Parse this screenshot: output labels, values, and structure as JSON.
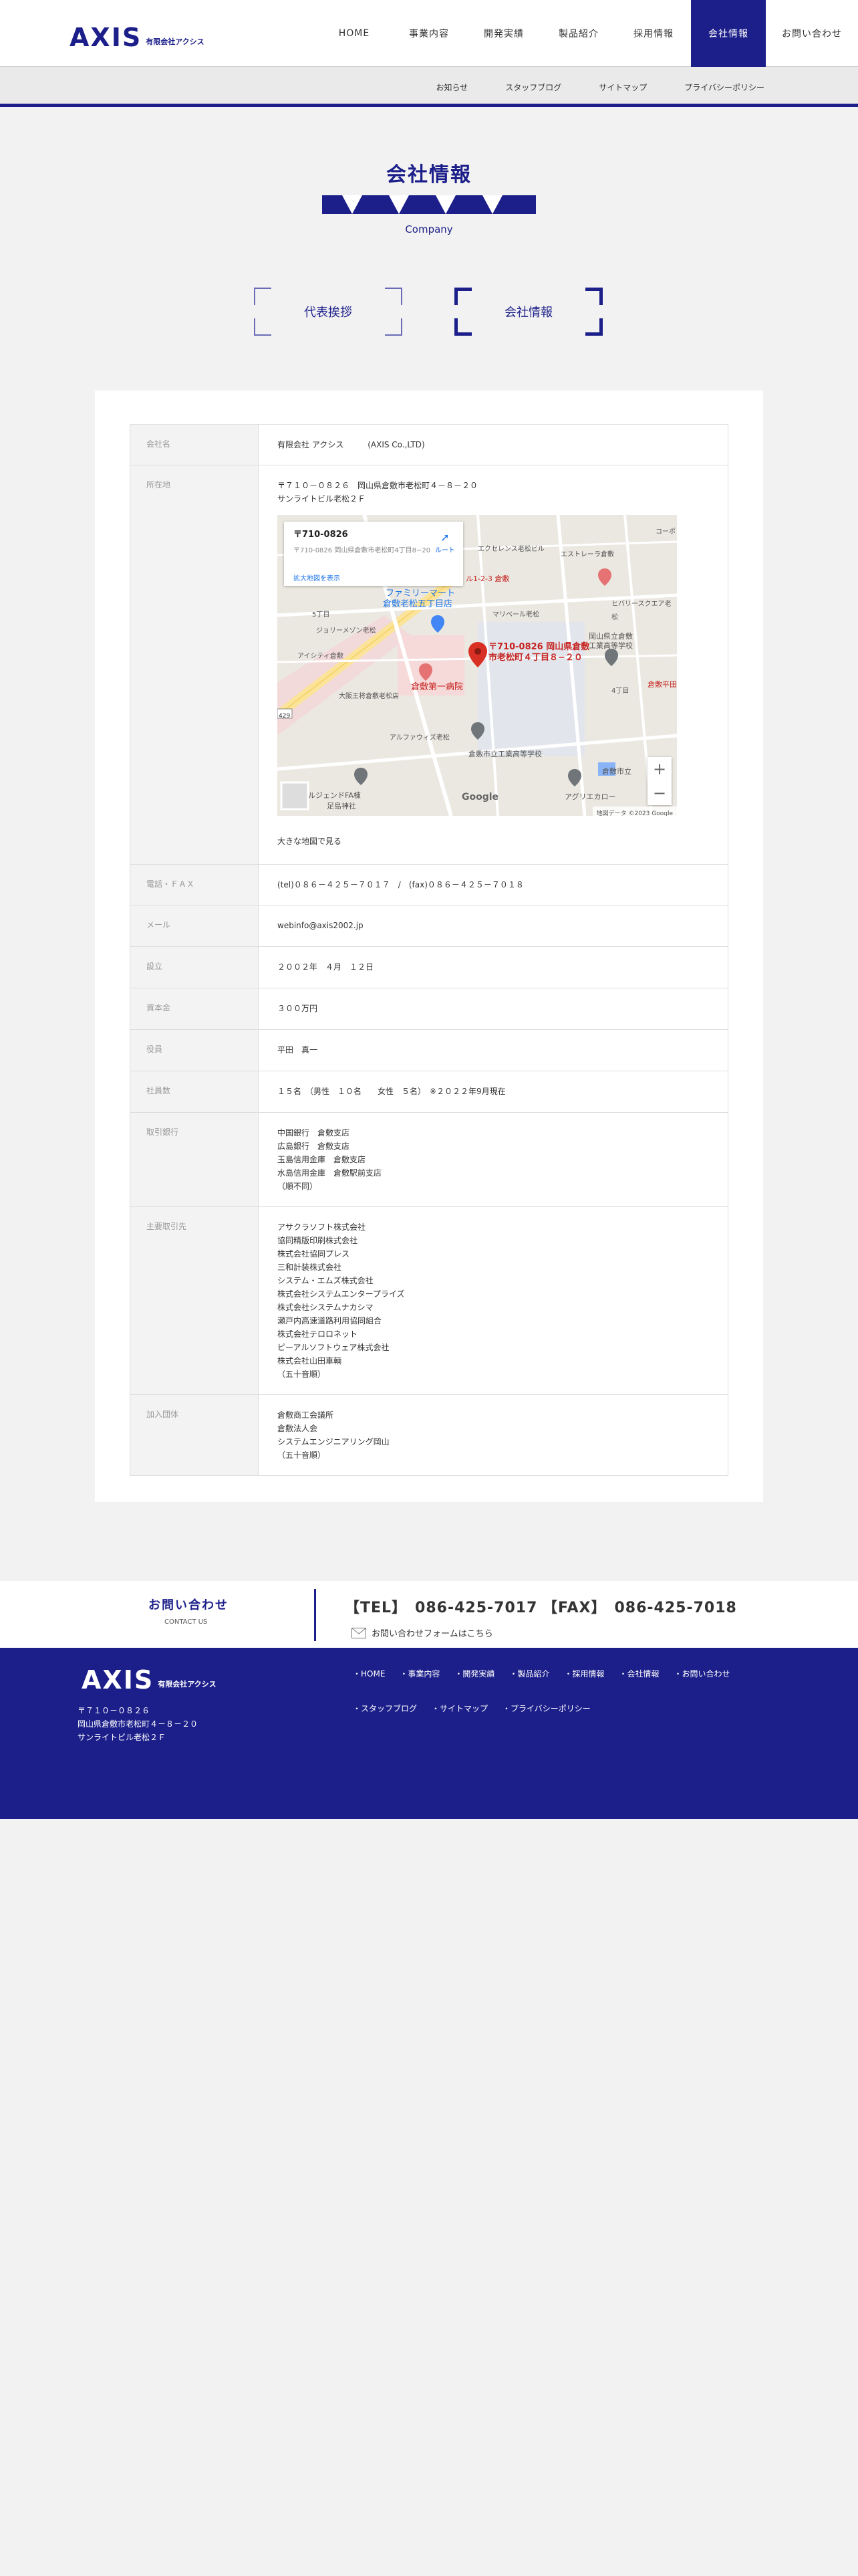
{
  "header": {
    "logo_text": "AXIS",
    "logo_sub": "有限会社アクシス",
    "nav": [
      {
        "label": "HOME"
      },
      {
        "label": "事業内容"
      },
      {
        "label": "開発実績"
      },
      {
        "label": "製品紹介"
      },
      {
        "label": "採用情報"
      },
      {
        "label": "会社情報",
        "active": true
      },
      {
        "label": "お問い合わせ"
      }
    ],
    "subnav": [
      "お知らせ",
      "スタッフブログ",
      "サイトマップ",
      "プライバシーポリシー"
    ]
  },
  "page": {
    "title": "会社情報",
    "title_en": "Company",
    "anchors": [
      "代表挨拶",
      "会社情報"
    ]
  },
  "company": {
    "rows": [
      {
        "label": "会社名",
        "value": "有限会社 アクシス　　　(AXIS Co.,LTD)"
      },
      {
        "label": "所在地"
      },
      {
        "label": "電話・ＦＡＸ",
        "value": "(tel)０８６－４２５－７０１７　/　(fax)０８６－４２５－７０１８"
      },
      {
        "label": "メール",
        "value": "webinfo@axis2002.jp"
      },
      {
        "label": "設立",
        "value": "２００２年　４月　１２日"
      },
      {
        "label": "資本金",
        "value": "３００万円"
      },
      {
        "label": "役員",
        "value": "平田　真一"
      },
      {
        "label": "社員数",
        "value": "１５名　（男性　１０名　　女性　５名）　※２０２２年9月現在"
      },
      {
        "label": "取引銀行",
        "lines": [
          "中国銀行　倉敷支店",
          "広島銀行　倉敷支店",
          "玉島信用金庫　倉敷支店",
          "水島信用金庫　倉敷駅前支店",
          "（順不同）"
        ]
      },
      {
        "label": "主要取引先",
        "lines": [
          "アサクラソフト株式会社",
          "協同精版印刷株式会社",
          "株式会社協同プレス",
          "三和計装株式会社",
          "システム・エムズ株式会社",
          "株式会社システムエンタープライズ",
          "株式会社システムナカシマ",
          "瀬戸内高速道路利用協同組合",
          "株式会社テロロネット",
          "ピーアルソフトウェア株式会社",
          "株式会社山田車輌",
          "（五十音順）"
        ]
      },
      {
        "label": "加入団体",
        "lines": [
          "倉敷商工会議所",
          "倉敷法人会",
          "システムエンジニアリング岡山",
          "（五十音順）"
        ]
      }
    ],
    "address": [
      "〒７１０－０８２６　岡山県倉敷市老松町４－８－２０",
      "サンライトビル老松２Ｆ"
    ],
    "map": {
      "card_postal": "〒710-0826",
      "card_addr": "〒710-0826 岡山県倉敷市老松町4丁目8−20",
      "card_link": "拡大地図を表示",
      "card_dir": "ルート",
      "pin_label_1": "〒710-0826 岡山県倉敷",
      "pin_label_2": "市老松町４丁目８−２０",
      "labels": [
        "ファミリーマート",
        "倉敷老松五丁目店",
        "倉敷第一病院",
        "倉敷市立工業高等学校",
        "エクセレンス老松ビル",
        "エストレーラ倉敷",
        "マリベール老松",
        "ジョリーメゾン老松",
        "アイシティ倉敷",
        "大阪王将倉敷老松店",
        "アルファウィズ老松",
        "ヒバリースクエア老松",
        "岡山県立倉敷",
        "工業高等学校",
        "倉敷市立",
        "アグリエカロー",
        "ルジェンドFA棟",
        "足島神社",
        "5丁目",
        "4丁目",
        "コーポ",
        "ル1-2-3 倉敷",
        "倉敷平田"
      ],
      "google": "Google",
      "footer": "地図データ ©2023 Google",
      "zoom_in": "+",
      "zoom_out": "−",
      "road": "429"
    },
    "big_map_link": "大きな地図で見る"
  },
  "contact": {
    "title": "お問い合わせ",
    "title_en": "CONTACT US",
    "tel": "【TEL】　086-425-7017",
    "fax": "【FAX】　086-425-7018",
    "mail_link": "お問い合わせフォームはこちら"
  },
  "footer": {
    "logo_text": "AXIS",
    "logo_sub": "有限会社アクシス",
    "address": [
      "〒７１０－０８２６",
      "岡山県倉敷市老松町４－８－２０",
      "サンライトビル老松２Ｆ"
    ],
    "nav1": [
      "・HOME",
      "・事業内容",
      "・開発実績",
      "・製品紹介",
      "・採用情報",
      "・会社情報",
      "・お問い合わせ"
    ],
    "nav2": [
      "・スタッフブログ",
      "・サイトマップ",
      "・プライバシーポリシー"
    ]
  },
  "colors": {
    "brand": "#1c1f8a",
    "map_pin": "#d93025"
  }
}
